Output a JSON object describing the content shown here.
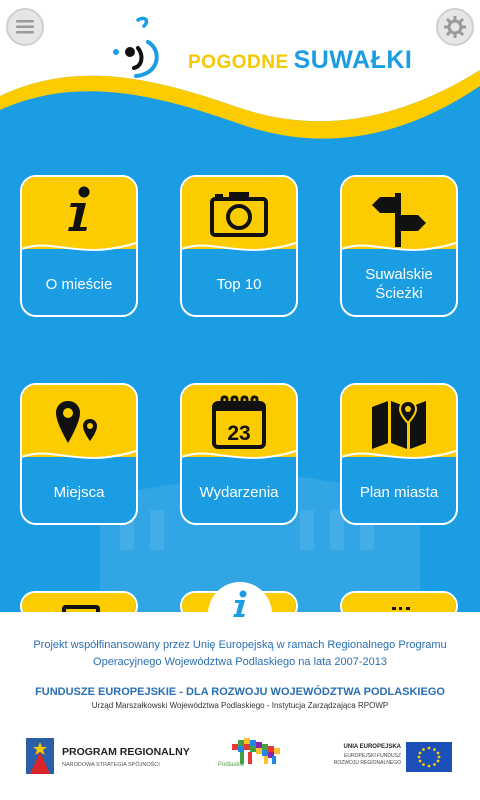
{
  "header": {
    "logo_small": "POGODNE",
    "logo_big": "SUWAŁKI"
  },
  "tiles": [
    {
      "label": "O mieście",
      "icon": "info-icon"
    },
    {
      "label": "Top 10",
      "icon": "camera-icon"
    },
    {
      "label": "Suwalskie Ścieżki",
      "icon": "signpost-icon"
    },
    {
      "label": "Miejsca",
      "icon": "map-pins-icon"
    },
    {
      "label": "Wydarzenia",
      "icon": "calendar-icon"
    },
    {
      "label": "Plan miasta",
      "icon": "map-icon"
    }
  ],
  "calendar_day": "23",
  "footer": {
    "line1": "Projekt współfinansowany przez Unię Europejską w ramach Regionalnego Programu",
    "line2": "Operacyjnego Województwa Podlaskiego na lata 2007-2013",
    "line3": "FUNDUSZE EUROPEJSKIE - DLA ROZWOJU WOJEWÓDZTWA PODLASKIEGO",
    "line4": "Urząd Marszałkowski Województwa Podlaskiego - Instytucja Zarządzająca RPOWP",
    "program_title": "PROGRAM REGIONALNY",
    "program_sub": "NARODOWA STRATEGIA SPÓJNOŚCI",
    "podlaskie": "Podlaskie",
    "ue_title": "UNIA EUROPEJSKA",
    "ue_sub1": "EUROPEJSKI FUNDUSZ",
    "ue_sub2": "ROZWOJU REGIONALNEGO"
  },
  "colors": {
    "brand_blue": "#1b9de3",
    "brand_yellow": "#fccc00"
  }
}
